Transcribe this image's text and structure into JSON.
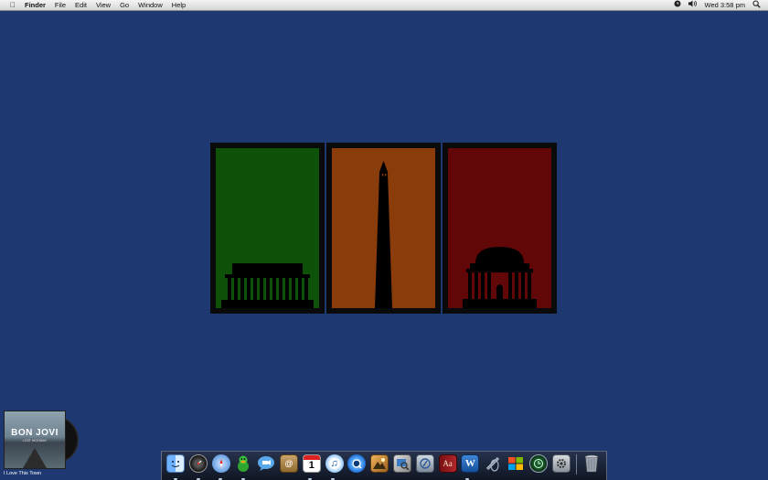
{
  "menubar": {
    "apple_icon": "apple-logo-icon",
    "app_name": "Finder",
    "menus": [
      "File",
      "Edit",
      "View",
      "Go",
      "Window",
      "Help"
    ],
    "status": {
      "clock": "Wed 3:58 pm",
      "status_icons": [
        "time-machine-icon",
        "volume-icon"
      ],
      "spotlight_icon": "spotlight-search-icon"
    }
  },
  "desktop": {
    "background_color": "#1e3872",
    "artwork_panels": [
      {
        "name": "lincoln-memorial",
        "color": "#0d5208"
      },
      {
        "name": "washington-monument",
        "color": "#8a3d0a"
      },
      {
        "name": "jefferson-memorial",
        "color": "#620707"
      }
    ]
  },
  "now_playing": {
    "album_artist": "BON JOVI",
    "album_subtitle": "LOST HIGHWAY",
    "track": "I Love This Town"
  },
  "dock": {
    "apps": [
      {
        "name": "finder",
        "icon": "finder-icon"
      },
      {
        "name": "dashboard",
        "icon": "dashboard-icon"
      },
      {
        "name": "safari",
        "icon": "safari-icon"
      },
      {
        "name": "adium",
        "icon": "adium-duck-icon"
      },
      {
        "name": "ichat",
        "icon": "ichat-icon"
      },
      {
        "name": "address-book",
        "icon": "address-book-icon"
      },
      {
        "name": "ical",
        "icon": "ical-icon",
        "label": "1"
      },
      {
        "name": "itunes",
        "icon": "itunes-icon"
      },
      {
        "name": "quicktime",
        "icon": "quicktime-icon"
      },
      {
        "name": "iphoto",
        "icon": "iphoto-icon"
      },
      {
        "name": "preview",
        "icon": "preview-icon"
      },
      {
        "name": "directory-utility",
        "icon": "directory-utility-icon"
      },
      {
        "name": "dictionary",
        "icon": "dictionary-icon",
        "label": "Aa"
      },
      {
        "name": "word",
        "icon": "word-icon"
      },
      {
        "name": "script-editor",
        "icon": "script-editor-icon"
      },
      {
        "name": "windows",
        "icon": "windows-logo-icon"
      },
      {
        "name": "time-machine",
        "icon": "time-machine-icon"
      },
      {
        "name": "system-preferences",
        "icon": "system-preferences-icon"
      },
      {
        "name": "trash",
        "icon": "trash-icon"
      }
    ]
  }
}
